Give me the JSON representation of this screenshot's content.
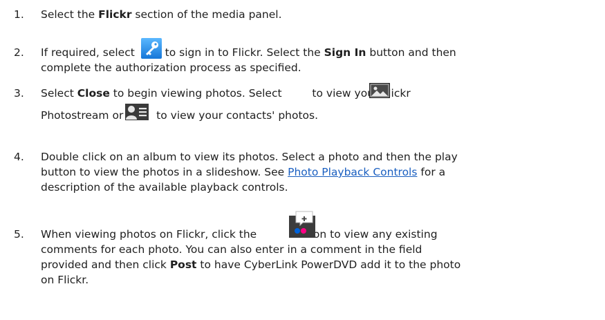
{
  "steps": [
    {
      "number": "1.",
      "line1": {
        "pre": "Select the ",
        "bold": "Flickr",
        "post": " section of the media panel."
      }
    },
    {
      "number": "2.",
      "line1": {
        "pre": "If required, select ",
        "mid": " to sign in to Flickr. Select the ",
        "bold": "Sign In",
        "post": " button and then"
      },
      "line2": "complete the authorization process as specified.",
      "icon": "key-icon"
    },
    {
      "number": "3.",
      "line1": {
        "pre": "Select ",
        "bold": "Close",
        "mid": " to begin viewing photos. Select ",
        "post": " to view your Flickr"
      },
      "line2": {
        "pre": "Photostream or ",
        "post": " to view your contacts' photos."
      },
      "icons": [
        "photostream-icon",
        "contacts-icon"
      ]
    },
    {
      "number": "4.",
      "line1": "Double click on an album to view its photos. Select a photo and then the play",
      "line2": "button to view the photos in a slideshow. See ",
      "link": "Photo Playback Controls",
      "line2_post": " for a",
      "line3": "description of the available playback controls."
    },
    {
      "number": "5.",
      "line1": {
        "pre": "When viewing photos on Flickr, click the ",
        "post": " button to view any existing"
      },
      "line2": "comments for each photo. You can also enter in a comment in the field",
      "line3": {
        "pre": "provided and then click ",
        "bold": "Post",
        "post": " to have CyberLink PowerDVD add it to the photo"
      },
      "line4": "on Flickr.",
      "icon": "comment-icon"
    }
  ],
  "colors": {
    "text": "#1e1e1e",
    "link": "#1a5fc0",
    "key_icon_bg": "#2a8fe8",
    "flickr_pink": "#ff0084",
    "flickr_blue": "#0063dc"
  }
}
